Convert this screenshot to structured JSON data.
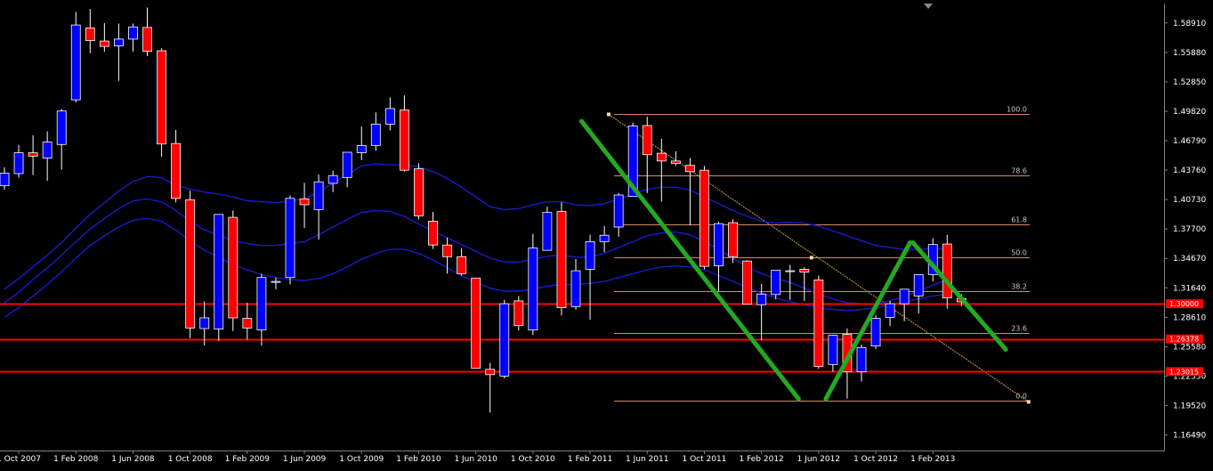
{
  "chart_data": {
    "type": "candlestick",
    "title": "",
    "xlabel": "",
    "ylabel": "",
    "ylim": [
      1.1489,
      1.6091
    ],
    "grid": false,
    "background": "#000000",
    "colors": {
      "bull_body": "#0000ff",
      "bear_body": "#ff0000",
      "wick": "#ffffff",
      "ma": "#1a1acc",
      "fib": "#d48a6a",
      "trend_diag": "#d4a040",
      "hline": "#ff0000",
      "pattern": "#22aa22",
      "axis_text": "#ffffff",
      "axis_line": "#808080"
    },
    "y_ticks": [
      "1.58910",
      "1.55880",
      "1.52850",
      "1.49820",
      "1.46790",
      "1.43760",
      "1.40730",
      "1.37700",
      "1.34670",
      "1.31640",
      "1.28610",
      "1.25580",
      "1.22550",
      "1.19520",
      "1.16490"
    ],
    "x_ticks": [
      {
        "label": "1 Oct 2007",
        "i": 1
      },
      {
        "label": "1 Feb 2008",
        "i": 5
      },
      {
        "label": "1 Jun 2008",
        "i": 9
      },
      {
        "label": "1 Oct 2008",
        "i": 13
      },
      {
        "label": "1 Feb 2009",
        "i": 17
      },
      {
        "label": "1 Jun 2009",
        "i": 21
      },
      {
        "label": "1 Oct 2009",
        "i": 25
      },
      {
        "label": "1 Feb 2010",
        "i": 29
      },
      {
        "label": "1 Jun 2010",
        "i": 33
      },
      {
        "label": "1 Oct 2010",
        "i": 37
      },
      {
        "label": "1 Feb 2011",
        "i": 41
      },
      {
        "label": "1 Jun 2011",
        "i": 45
      },
      {
        "label": "1 Oct 2011",
        "i": 49
      },
      {
        "label": "1 Feb 2012",
        "i": 53
      },
      {
        "label": "1 Jun 2012",
        "i": 57
      },
      {
        "label": "1 Oct 2012",
        "i": 61
      },
      {
        "label": "1 Feb 2013",
        "i": 65
      }
    ],
    "candles": [
      [
        1.4215,
        1.4405,
        1.4175,
        1.4345
      ],
      [
        1.434,
        1.4635,
        1.43,
        1.4555
      ],
      [
        1.4555,
        1.4735,
        1.4325,
        1.452
      ],
      [
        1.45,
        1.4775,
        1.4265,
        1.4665
      ],
      [
        1.464,
        1.5005,
        1.438,
        1.4985
      ],
      [
        1.51,
        1.6005,
        1.5075,
        1.587
      ],
      [
        1.584,
        1.6035,
        1.558,
        1.571
      ],
      [
        1.5705,
        1.589,
        1.5595,
        1.565
      ],
      [
        1.5655,
        1.5885,
        1.5295,
        1.5725
      ],
      [
        1.5725,
        1.5885,
        1.5595,
        1.585
      ],
      [
        1.5845,
        1.605,
        1.555,
        1.56
      ],
      [
        1.5605,
        1.563,
        1.4515,
        1.4645
      ],
      [
        1.465,
        1.479,
        1.4045,
        1.4085
      ],
      [
        1.407,
        1.4165,
        1.2645,
        1.275
      ],
      [
        1.2745,
        1.3025,
        1.257,
        1.2855
      ],
      [
        1.274,
        1.385,
        1.2615,
        1.392
      ],
      [
        1.389,
        1.396,
        1.272,
        1.2855
      ],
      [
        1.285,
        1.301,
        1.263,
        1.275
      ],
      [
        1.273,
        1.331,
        1.257,
        1.327
      ],
      [
        1.323,
        1.327,
        1.315,
        1.323
      ],
      [
        1.327,
        1.4115,
        1.32,
        1.4085
      ],
      [
        1.408,
        1.4245,
        1.378,
        1.402
      ],
      [
        1.397,
        1.433,
        1.366,
        1.4255
      ],
      [
        1.424,
        1.437,
        1.415,
        1.432
      ],
      [
        1.43,
        1.445,
        1.42,
        1.456
      ],
      [
        1.4555,
        1.4825,
        1.448,
        1.463
      ],
      [
        1.463,
        1.497,
        1.4575,
        1.485
      ],
      [
        1.485,
        1.5125,
        1.4785,
        1.501
      ],
      [
        1.4995,
        1.5145,
        1.436,
        1.4375
      ],
      [
        1.439,
        1.4445,
        1.387,
        1.3905
      ],
      [
        1.385,
        1.3945,
        1.3565,
        1.3605
      ],
      [
        1.3605,
        1.368,
        1.331,
        1.3485
      ],
      [
        1.3485,
        1.357,
        1.329,
        1.331
      ],
      [
        1.3265,
        1.3265,
        1.237,
        1.2335
      ],
      [
        1.2325,
        1.239,
        1.188,
        1.227
      ],
      [
        1.2255,
        1.304,
        1.223,
        1.3
      ],
      [
        1.303,
        1.308,
        1.2725,
        1.2775
      ],
      [
        1.273,
        1.372,
        1.268,
        1.3575
      ],
      [
        1.355,
        1.4,
        1.356,
        1.394
      ],
      [
        1.395,
        1.4045,
        1.288,
        1.296
      ],
      [
        1.297,
        1.346,
        1.294,
        1.334
      ],
      [
        1.3355,
        1.371,
        1.2835,
        1.364
      ],
      [
        1.364,
        1.38,
        1.353,
        1.3705
      ],
      [
        1.379,
        1.414,
        1.369,
        1.412
      ],
      [
        1.4105,
        1.4865,
        1.411,
        1.483
      ],
      [
        1.4835,
        1.4925,
        1.414,
        1.4535
      ],
      [
        1.455,
        1.47,
        1.405,
        1.447
      ],
      [
        1.447,
        1.457,
        1.442,
        1.4445
      ],
      [
        1.4425,
        1.45,
        1.381,
        1.436
      ],
      [
        1.4375,
        1.442,
        1.3355,
        1.3385
      ],
      [
        1.339,
        1.3845,
        1.313,
        1.3825
      ],
      [
        1.3835,
        1.387,
        1.342,
        1.3485
      ],
      [
        1.344,
        1.345,
        1.303,
        1.2995
      ],
      [
        1.299,
        1.3205,
        1.2625,
        1.31
      ],
      [
        1.3095,
        1.3345,
        1.3045,
        1.3345
      ],
      [
        1.334,
        1.34,
        1.304,
        1.334
      ],
      [
        1.3355,
        1.3375,
        1.303,
        1.3325
      ],
      [
        1.3245,
        1.329,
        1.233,
        1.2355
      ],
      [
        1.2375,
        1.268,
        1.23,
        1.2675
      ],
      [
        1.2685,
        1.2745,
        1.2025,
        1.23
      ],
      [
        1.23,
        1.258,
        1.22,
        1.255
      ],
      [
        1.2565,
        1.288,
        1.2535,
        1.285
      ],
      [
        1.286,
        1.303,
        1.277,
        1.3
      ],
      [
        1.3,
        1.313,
        1.282,
        1.315
      ],
      [
        1.308,
        1.32,
        1.29,
        1.33
      ],
      [
        1.33,
        1.3675,
        1.323,
        1.361
      ],
      [
        1.3615,
        1.371,
        1.295,
        1.306
      ],
      [
        1.3055,
        1.31,
        1.2975,
        1.302
      ]
    ],
    "moving_averages": [
      {
        "values": [
          1.315,
          1.326,
          1.338,
          1.35,
          1.363,
          1.378,
          1.392,
          1.404,
          1.416,
          1.426,
          1.431,
          1.43,
          1.422,
          1.418,
          1.415,
          1.413,
          1.41,
          1.406,
          1.405,
          1.404,
          1.406,
          1.408,
          1.415,
          1.424,
          1.433,
          1.442,
          1.444,
          1.443,
          1.443,
          1.441,
          1.436,
          1.429,
          1.42,
          1.41,
          1.4,
          1.397,
          1.398,
          1.402,
          1.405,
          1.405,
          1.402,
          1.401,
          1.403,
          1.408,
          1.413,
          1.418,
          1.42,
          1.42,
          1.417,
          1.41,
          1.403,
          1.396,
          1.39,
          1.385,
          1.383,
          1.384,
          1.383,
          1.38,
          1.375,
          1.37,
          1.365,
          1.36,
          1.358,
          1.356,
          1.356,
          1.357,
          1.356
        ]
      },
      {
        "values": [
          1.301,
          1.312,
          1.325,
          1.337,
          1.35,
          1.364,
          1.377,
          1.388,
          1.398,
          1.406,
          1.408,
          1.405,
          1.396,
          1.385,
          1.376,
          1.371,
          1.365,
          1.362,
          1.36,
          1.36,
          1.362,
          1.364,
          1.371,
          1.379,
          1.387,
          1.394,
          1.396,
          1.395,
          1.39,
          1.382,
          1.375,
          1.368,
          1.361,
          1.354,
          1.347,
          1.343,
          1.343,
          1.346,
          1.349,
          1.35,
          1.348,
          1.348,
          1.352,
          1.358,
          1.364,
          1.37,
          1.373,
          1.374,
          1.371,
          1.364,
          1.356,
          1.347,
          1.338,
          1.331,
          1.326,
          1.322,
          1.316,
          1.31,
          1.305,
          1.301,
          1.3,
          1.3,
          1.303,
          1.308,
          1.313,
          1.319,
          1.325
        ]
      },
      {
        "values": [
          1.286,
          1.296,
          1.308,
          1.32,
          1.333,
          1.347,
          1.36,
          1.37,
          1.379,
          1.386,
          1.388,
          1.385,
          1.376,
          1.365,
          1.355,
          1.348,
          1.34,
          1.335,
          1.33,
          1.327,
          1.325,
          1.324,
          1.326,
          1.331,
          1.338,
          1.346,
          1.352,
          1.356,
          1.356,
          1.352,
          1.345,
          1.337,
          1.329,
          1.322,
          1.316,
          1.313,
          1.313,
          1.315,
          1.318,
          1.32,
          1.32,
          1.321,
          1.323,
          1.327,
          1.331,
          1.335,
          1.338,
          1.339,
          1.338,
          1.335,
          1.329,
          1.323,
          1.317,
          1.311,
          1.306,
          1.302,
          1.299,
          1.296,
          1.294,
          1.293,
          1.294,
          1.296,
          1.299,
          1.302,
          1.305,
          1.308,
          1.31
        ]
      }
    ],
    "fibonacci": {
      "start": 1.495,
      "end": 1.2,
      "levels": [
        {
          "label": "100.0",
          "value": 1.495
        },
        {
          "label": "78.6",
          "value": 1.432
        },
        {
          "label": "61.8",
          "value": 1.382
        },
        {
          "label": "50.0",
          "value": 1.3475
        },
        {
          "label": "38.2",
          "value": 1.313
        },
        {
          "label": "23.6",
          "value": 1.27
        },
        {
          "label": "0.0",
          "value": 1.2
        }
      ]
    },
    "horizontal_lines": [
      {
        "label": "1.30000",
        "value": 1.3
      },
      {
        "label": "1.26378",
        "value": 1.2638
      },
      {
        "label": "1.23015",
        "value": 1.2302
      }
    ],
    "pattern_lines": [
      {
        "from": {
          "i": 40.4,
          "y": 1.488
        },
        "to": {
          "i": 55.6,
          "y": 1.202
        }
      },
      {
        "from": {
          "i": 57.5,
          "y": 1.202
        },
        "to": {
          "i": 63.4,
          "y": 1.363
        }
      },
      {
        "from": {
          "i": 63.6,
          "y": 1.363
        },
        "to": {
          "i": 70.1,
          "y": 1.253
        }
      }
    ],
    "trend_line": {
      "from": {
        "i": 42.3,
        "y": 1.495
      },
      "to": {
        "i": 71.7,
        "y": 1.199
      }
    }
  }
}
